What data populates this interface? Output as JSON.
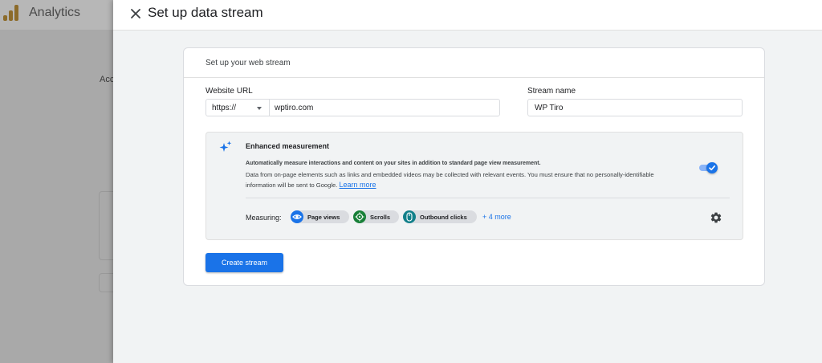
{
  "background": {
    "app_title": "Analytics",
    "partial_text": "Acc"
  },
  "panel": {
    "close_icon": "close-icon",
    "title": "Set up data stream"
  },
  "web_stream": {
    "heading": "Set up your web stream",
    "website_url_label": "Website URL",
    "protocol_value": "https://",
    "url_value": "wptiro.com",
    "stream_name_label": "Stream name",
    "stream_name_value": "WP Tiro"
  },
  "enhanced_measurement": {
    "icon": "sparkle-icon",
    "title": "Enhanced measurement",
    "description_bold": "Automatically measure interactions and content on your sites in addition to standard page view measurement.",
    "description": "Data from on-page elements such as links and embedded videos may be collected with relevant events. You must ensure that no personally-identifiable information will be sent to Google.",
    "learn_more": "Learn more",
    "toggle_on": true,
    "measuring_label": "Measuring:",
    "chips": [
      {
        "label": "Page views",
        "icon": "eye-icon",
        "color": "#1a73e8"
      },
      {
        "label": "Scrolls",
        "icon": "crosshair-icon",
        "color": "#188038"
      },
      {
        "label": "Outbound clicks",
        "icon": "mouse-icon",
        "color": "#12808a"
      }
    ],
    "more": "+ 4 more",
    "settings_icon": "gear-icon"
  },
  "actions": {
    "create_label": "Create stream"
  },
  "colors": {
    "accent": "#1a73e8"
  }
}
